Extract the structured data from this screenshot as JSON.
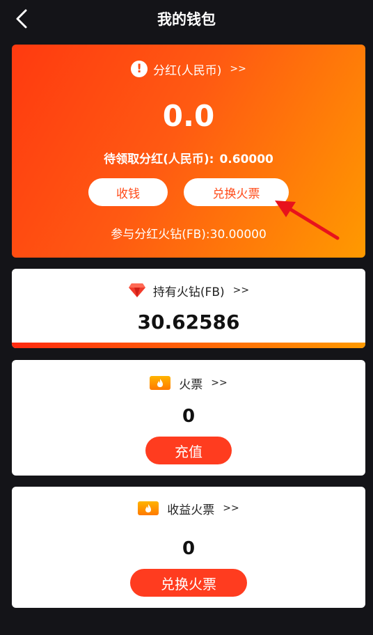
{
  "header": {
    "title": "我的钱包",
    "back_icon": "chevron-left-icon"
  },
  "dividend": {
    "title": "分红(人民币)",
    "more": ">>",
    "amount": "0.0",
    "pending_label": "待领取分红(人民币):",
    "pending_value": "0.60000",
    "collect_label": "收钱",
    "exchange_label": "兑换火票",
    "fb_join_text": "参与分红火钻(FB):30.00000",
    "gradient_start": "#ff3a10",
    "gradient_end": "#ff9a00"
  },
  "holdings": {
    "title": "持有火钻(FB)",
    "more": ">>",
    "value": "30.62586",
    "icon": "diamond-icon"
  },
  "tickets": {
    "title": "火票",
    "more": ">>",
    "value": "0",
    "recharge_label": "充值",
    "icon": "flame-ticket-icon"
  },
  "income": {
    "title": "收益火票",
    "more": ">>",
    "value": "0",
    "exchange_label": "兑换火票",
    "icon": "flame-ticket-icon"
  },
  "colors": {
    "background": "#141418",
    "accent_red": "#ff3c1f",
    "annotation_arrow": "#e8121c"
  }
}
